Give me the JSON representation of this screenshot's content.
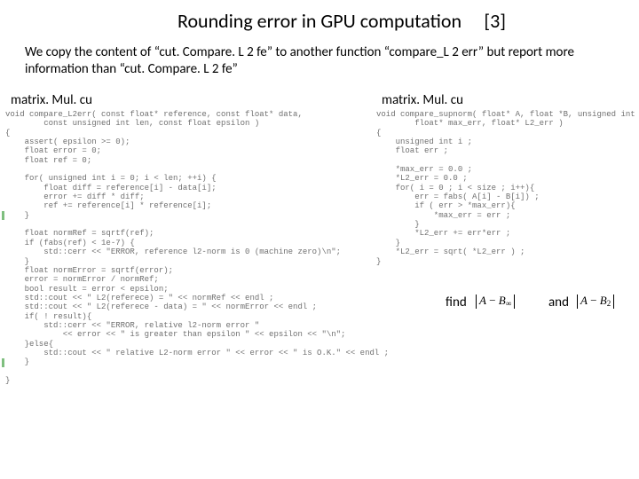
{
  "title": "Rounding error in GPU computation",
  "title_index": "[3]",
  "body_text": "We copy the content of “cut. Compare. L 2 fe” to another function “compare_L 2 err” but report more information than “cut. Compare. L 2 fe”",
  "caption_left": "matrix. Mul. cu",
  "caption_right": "matrix. Mul. cu",
  "code_left": "void compare_L2err( const float* reference, const float* data,\n        const unsigned int len, const float epsilon )\n{\n    assert( epsilon >= 0);\n    float error = 0;\n    float ref = 0;\n\n    for( unsigned int i = 0; i < len; ++i) {\n        float diff = reference[i] - data[i];\n        error += diff * diff;\n        ref += reference[i] * reference[i];\n    }\n\n    float normRef = sqrtf(ref);\n    if (fabs(ref) < 1e-7) {\n        std::cerr << \"ERROR, reference l2-norm is 0 (machine zero)\\n\";\n    }\n    float normError = sqrtf(error);\n    error = normError / normRef;\n    bool result = error < epsilon;\n    std::cout << \" L2(referece) = \" << normRef << endl ;\n    std::cout << \" L2(referece - data) = \" << normError << endl ;\n    if( ! result){\n        std::cerr << \"ERROR, relative l2-norm error \"\n            << error << \" is greater than epsilon \" << epsilon << \"\\n\";\n    }else{\n        std::cout << \" relative L2-norm error \" << error << \" is O.K.\" << endl ;\n    }\n\n}",
  "code_right": "void compare_supnorm( float* A, float *B, unsigned int size,\n        float* max_err, float* L2_err )\n{\n    unsigned int i ;\n    float err ;\n\n    *max_err = 0.0 ;\n    *L2_err = 0.0 ;\n    for( i = 0 ; i < size ; i++){\n        err = fabs( A[i] - B[i]) ;\n        if ( err > *max_err){\n            *max_err = err ;\n        }\n        *L2_err += err*err ;\n    }\n    *L2_err = sqrt( *L2_err ) ;\n}",
  "find_label": "find",
  "and_label": "and",
  "norm1_html": "<i>A</i> − <i>B</i>",
  "norm1_sub": "∞",
  "norm2_html": "<i>A</i> − <i>B</i>",
  "norm2_sub": "2"
}
